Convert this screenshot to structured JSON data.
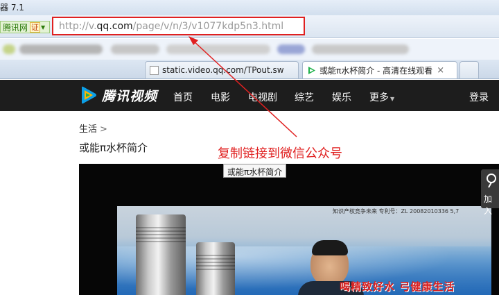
{
  "browser": {
    "title": "器 7.1",
    "site_badge": {
      "name": "腾讯网",
      "cert": "证"
    },
    "address": {
      "scheme_prefix": "http://v.",
      "host": "qq.com",
      "path": "/page/v/n/3/v1077kdp5n3.html"
    },
    "tabs": [
      {
        "label": "static.video.qq.com/TPout.sw"
      },
      {
        "label": "或能π水杯简介 - 高清在线观看"
      }
    ],
    "tab_close": "×"
  },
  "site": {
    "logo_text": "腾讯视频",
    "nav": [
      "首页",
      "电影",
      "电视剧",
      "综艺",
      "娱乐",
      "更多"
    ],
    "login": "登录"
  },
  "page": {
    "breadcrumb": "生活",
    "breadcrumb_sep": ">",
    "video_title": "或能π水杯简介",
    "tooltip": "或能π水杯简介",
    "side_widget_label": "加入"
  },
  "annotation": {
    "text": "复制链接到微信公众号",
    "color": "#e02020"
  },
  "video_frame": {
    "caption": "知识产权竞争未来  专利号：ZL 20082010336 5,7",
    "slogan": "喝精致好水 弓健康生活"
  },
  "colors": {
    "nav_bg": "#1d1d1d",
    "highlight": "#e02020",
    "logo_accent": "#0c9fe6"
  }
}
